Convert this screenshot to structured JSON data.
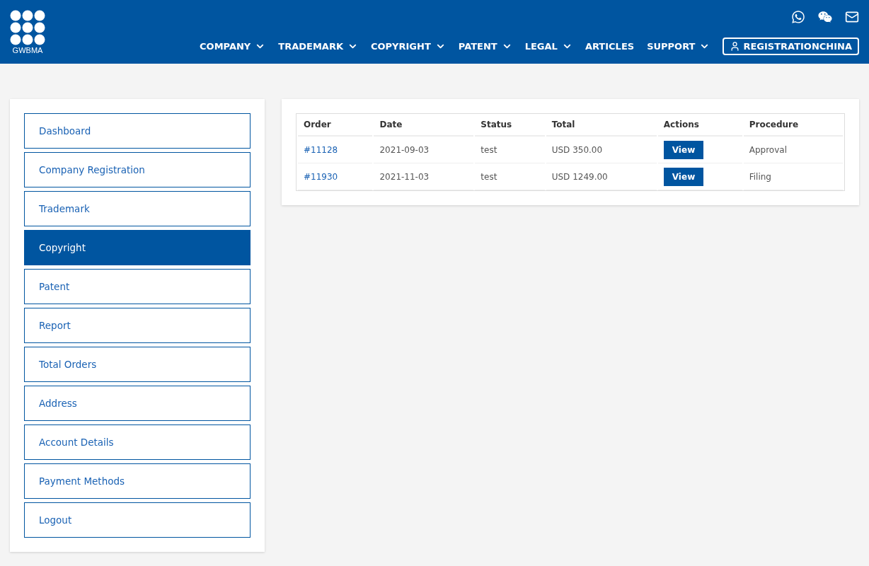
{
  "header": {
    "logo_text": "GWBMA",
    "nav": [
      {
        "label": "COMPANY",
        "dropdown": true
      },
      {
        "label": "TRADEMARK",
        "dropdown": true
      },
      {
        "label": "COPYRIGHT",
        "dropdown": true
      },
      {
        "label": "PATENT",
        "dropdown": true
      },
      {
        "label": "LEGAL",
        "dropdown": true
      },
      {
        "label": "ARTICLES",
        "dropdown": false
      },
      {
        "label": "SUPPORT",
        "dropdown": true
      }
    ],
    "account_button": "REGISTRATIONCHINA"
  },
  "sidebar": {
    "items": [
      {
        "label": "Dashboard",
        "selected": false
      },
      {
        "label": "Company Registration",
        "selected": false
      },
      {
        "label": "Trademark",
        "selected": false
      },
      {
        "label": "Copyright",
        "selected": true
      },
      {
        "label": "Patent",
        "selected": false
      },
      {
        "label": "Report",
        "selected": false
      },
      {
        "label": "Total Orders",
        "selected": false
      },
      {
        "label": "Address",
        "selected": false
      },
      {
        "label": "Account Details",
        "selected": false
      },
      {
        "label": "Payment Methods",
        "selected": false
      },
      {
        "label": "Logout",
        "selected": false
      }
    ]
  },
  "table": {
    "columns": [
      "Order",
      "Date",
      "Status",
      "Total",
      "Actions",
      "Procedure"
    ],
    "rows": [
      {
        "order": "#11128",
        "date": "2021-09-03",
        "status": "test",
        "total": "USD 350.00",
        "action": "View",
        "procedure": "Approval"
      },
      {
        "order": "#11930",
        "date": "2021-11-03",
        "status": "test",
        "total": "USD 1249.00",
        "action": "View",
        "procedure": "Filing"
      }
    ]
  }
}
